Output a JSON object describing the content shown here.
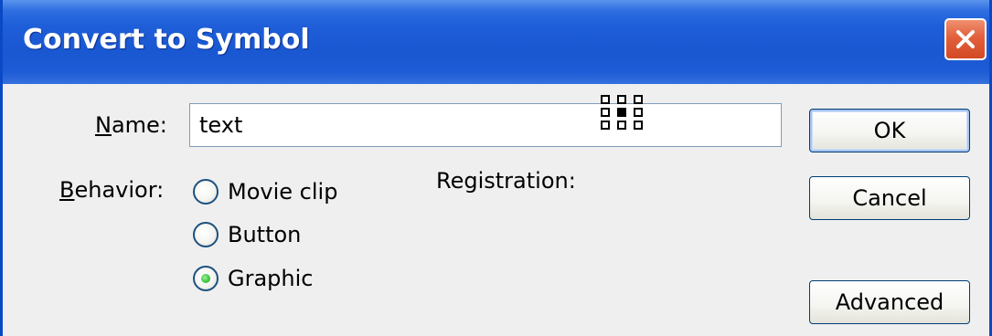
{
  "window": {
    "title": "Convert to Symbol"
  },
  "form": {
    "name_label_key": "N",
    "name_label_rest": "ame:",
    "name_value": "text",
    "behavior_label_key": "B",
    "behavior_label_rest": "ehavior:",
    "behavior_options": [
      {
        "label": "Movie clip",
        "selected": false
      },
      {
        "label": "Button",
        "selected": false
      },
      {
        "label": "Graphic",
        "selected": true
      }
    ],
    "registration_label": "Registration:",
    "registration_selected": "center"
  },
  "buttons": {
    "ok": "OK",
    "cancel": "Cancel",
    "advanced": "Advanced"
  },
  "icons": {
    "close": "close-icon",
    "registration": "registration-grid-icon"
  },
  "colors": {
    "titlebar": "#1a58d2",
    "close_button": "#e2603c",
    "dialog_bg": "#efefef",
    "radio_selected_dot": "#39c439"
  }
}
